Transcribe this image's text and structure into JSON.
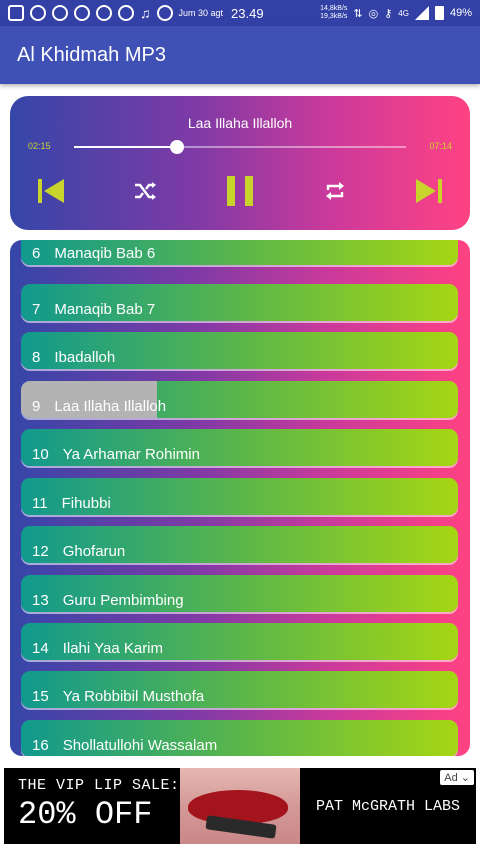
{
  "status_bar": {
    "date": "Jum 30 agt",
    "time": "23.49",
    "speed_up": "14,8kB/s",
    "speed_down": "19,3kB/s",
    "network": "4G",
    "battery": "49%"
  },
  "app_bar": {
    "title": "Al Khidmah MP3"
  },
  "player": {
    "title": "Laa Illaha Illalloh",
    "current_time": "02:15",
    "total_time": "07:14",
    "progress": 0.31
  },
  "playlist": {
    "items": [
      {
        "num": "6",
        "title": "Manaqib Bab 6"
      },
      {
        "num": "7",
        "title": "Manaqib Bab 7"
      },
      {
        "num": "8",
        "title": "Ibadalloh"
      },
      {
        "num": "9",
        "title": "Laa Illaha Illalloh"
      },
      {
        "num": "10",
        "title": "Ya Arhamar Rohimin"
      },
      {
        "num": "11",
        "title": "Fihubbi"
      },
      {
        "num": "12",
        "title": "Ghofarun"
      },
      {
        "num": "13",
        "title": "Guru Pembimbing"
      },
      {
        "num": "14",
        "title": "Ilahi Yaa Karim"
      },
      {
        "num": "15",
        "title": "Ya Robbibil Musthofa"
      },
      {
        "num": "16",
        "title": "Shollatullohi Wassalam"
      }
    ]
  },
  "ad": {
    "headline": "THE VIP LIP SALE:",
    "offer": "20% OFF",
    "brand": "PAT McGRATH LABS",
    "badge": "Ad"
  },
  "colors": {
    "app_bar": "#3f51b5",
    "accent_lime": "#c9d42a",
    "gradient_start": "#3546a8",
    "gradient_end": "#ff4283"
  }
}
